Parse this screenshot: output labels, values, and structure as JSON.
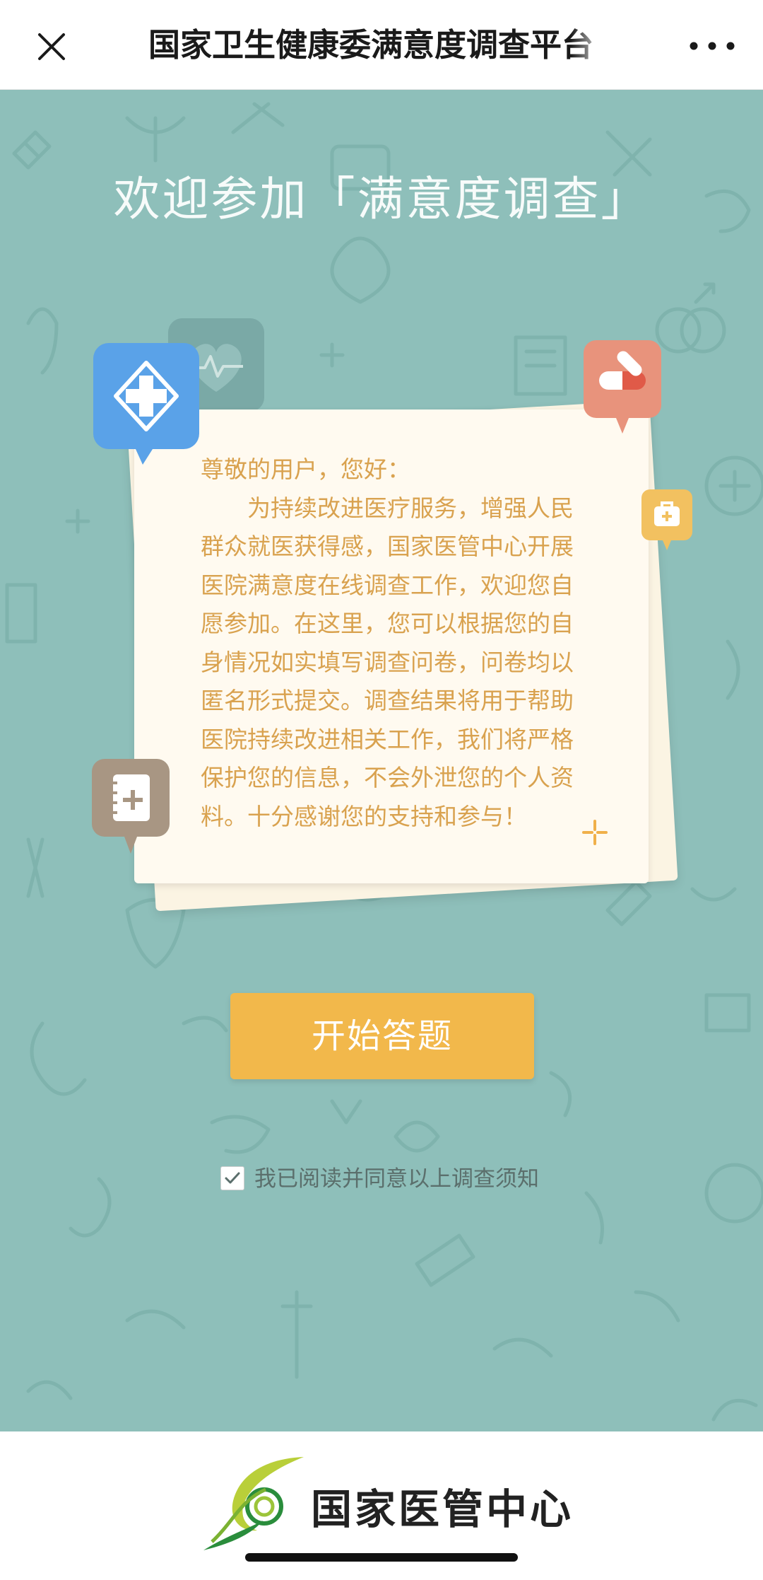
{
  "header": {
    "title": "国家卫生健康委满意度调查平台",
    "close_icon": "close-icon",
    "more_icon": "more-dots-icon"
  },
  "main": {
    "welcome": "欢迎参加「满意度调查」",
    "letter": {
      "greeting": "尊敬的用户，您好：",
      "body": "为持续改进医疗服务，增强人民群众就医获得感，国家医管中心开展医院满意度在线调查工作，欢迎您自愿参加。在这里，您可以根据您的自身情况如实填写调查问卷，问卷均以匿名形式提交。调查结果将用于帮助医院持续改进相关工作，我们将严格保护您的信息，不会外泄您的个人资料。十分感谢您的支持和参与！"
    },
    "badges": {
      "hospital": "hospital-cross-icon",
      "pill": "pill-icon",
      "medkit": "medical-kit-icon",
      "notebook": "medical-record-icon"
    },
    "start_button": "开始答题",
    "agreement": {
      "checked": true,
      "label": "我已阅读并同意以上调查须知"
    }
  },
  "footer": {
    "logo_text": "国家医管中心"
  },
  "colors": {
    "teal_bg": "#8ebfba",
    "button": "#f2b84b",
    "letter_text": "#d9a24f",
    "paper": "#fffaf0",
    "badge_blue": "#5aa2e8",
    "badge_red": "#e8937c",
    "badge_yellow": "#f2c160",
    "badge_brown": "#a89683"
  }
}
